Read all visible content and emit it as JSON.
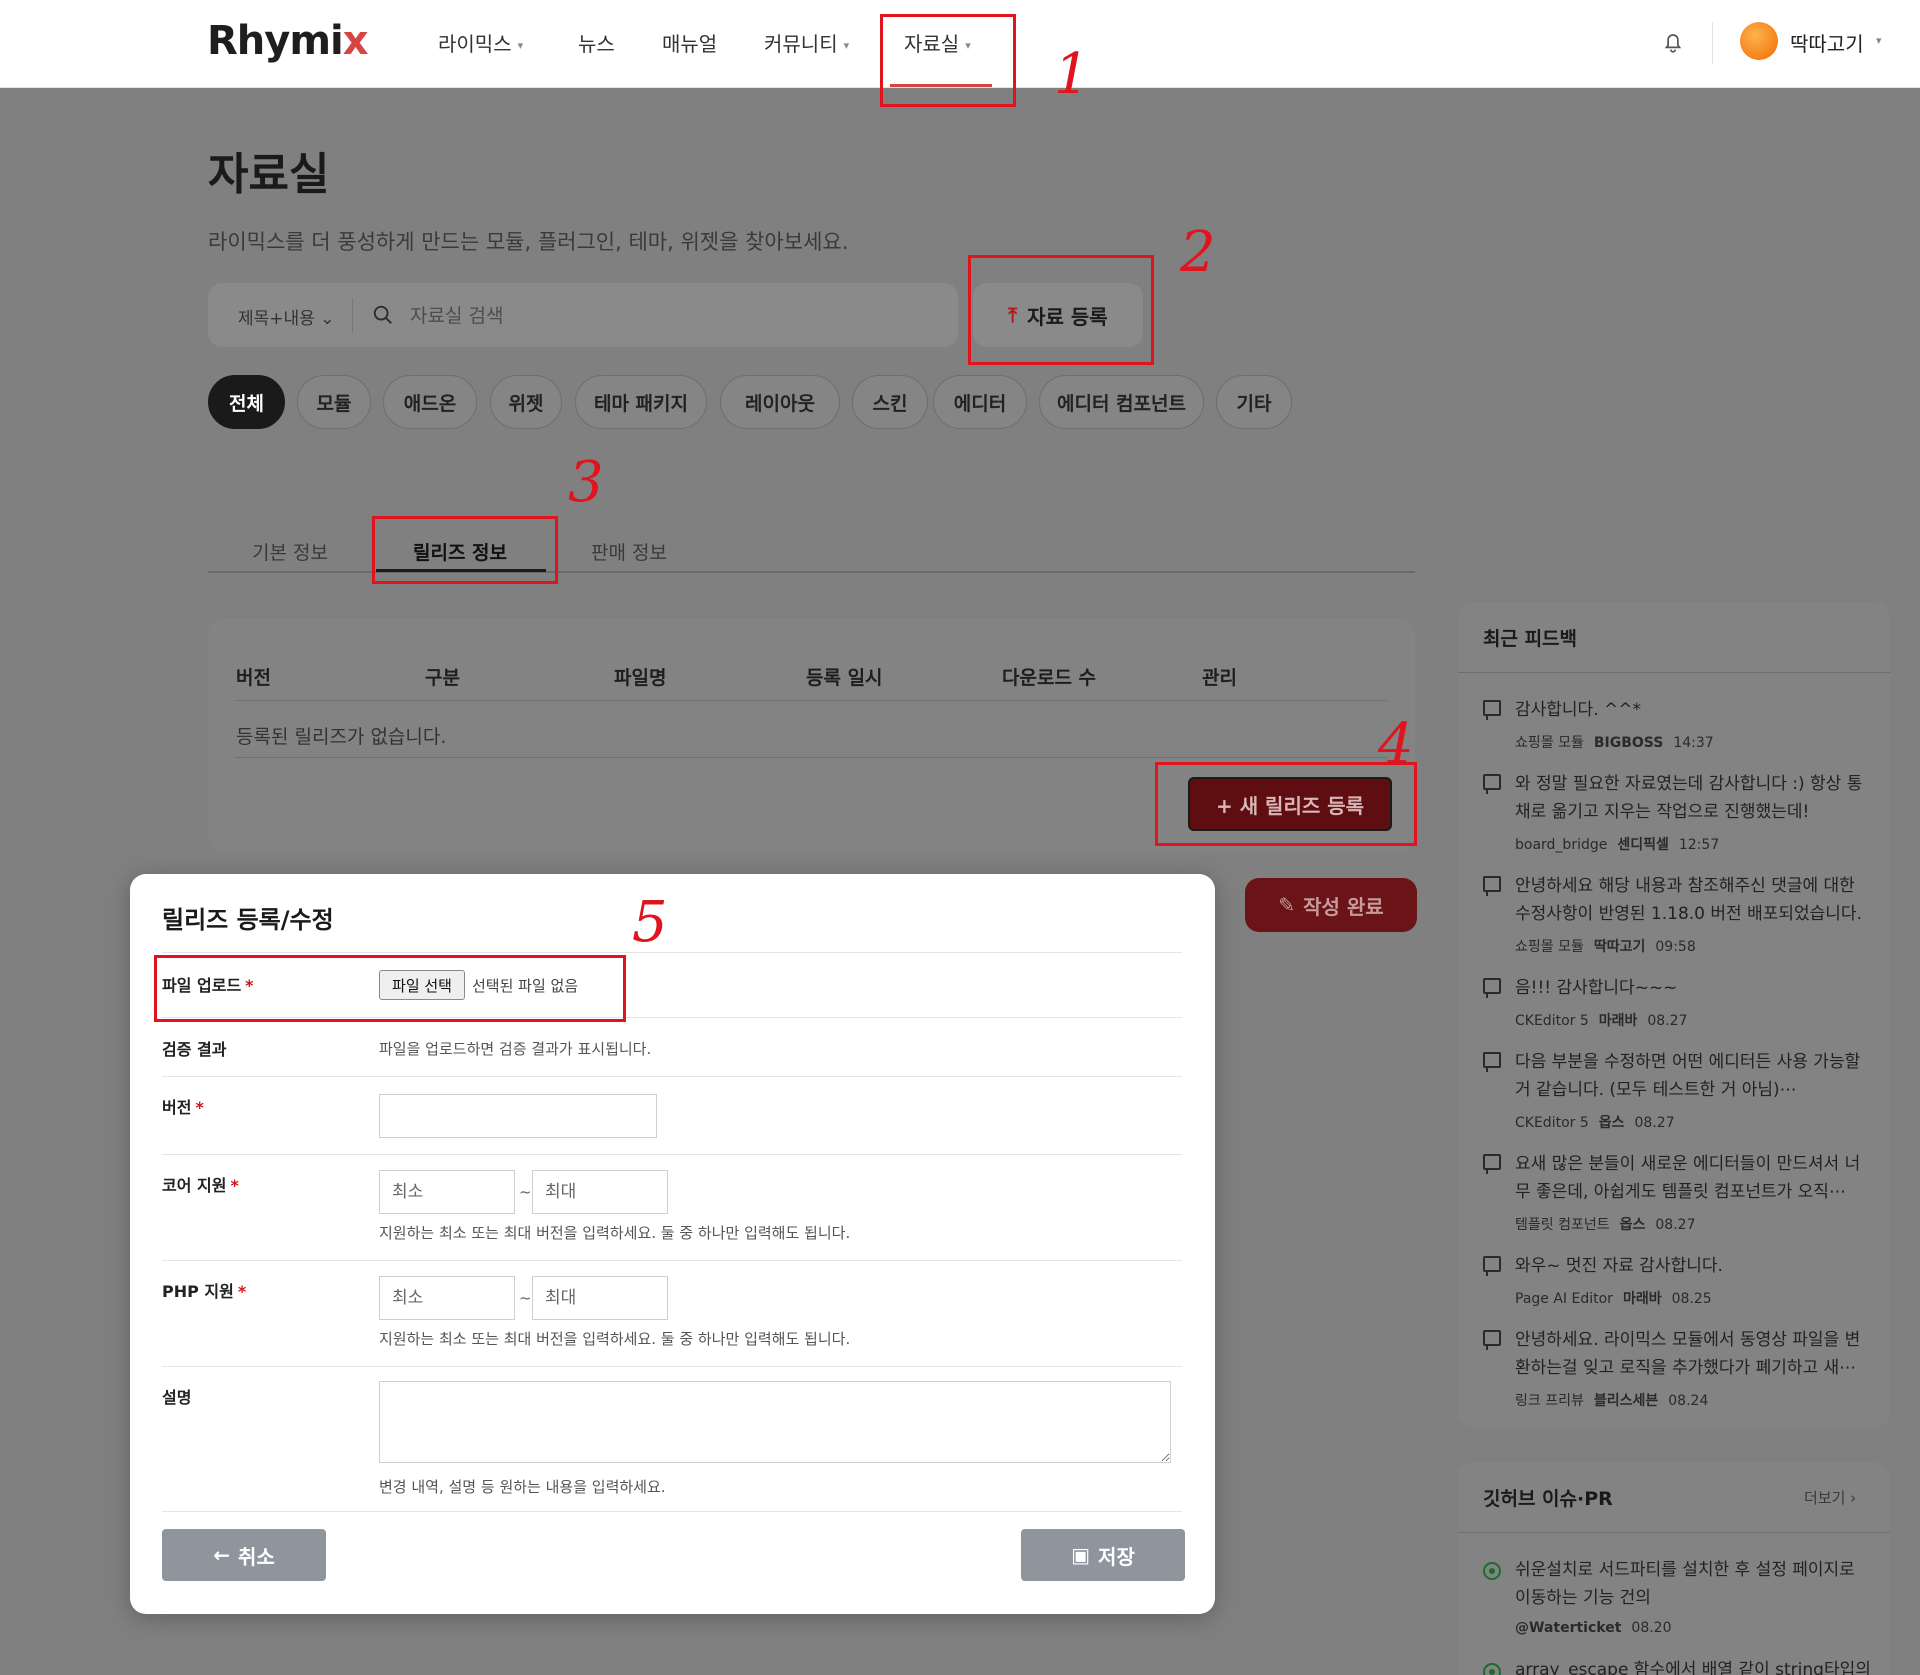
{
  "header": {
    "logo_main": "Rhymi",
    "logo_accent": "x",
    "nav": [
      {
        "label": "라이믹스",
        "has_caret": true
      },
      {
        "label": "뉴스",
        "has_caret": false
      },
      {
        "label": "매뉴얼",
        "has_caret": false
      },
      {
        "label": "커뮤니티",
        "has_caret": true
      },
      {
        "label": "자료실",
        "has_caret": true
      }
    ],
    "caret": "▾",
    "active_nav": "자료실",
    "username": "딱따고기"
  },
  "annotations": {
    "n1": "1",
    "n2": "2",
    "n3": "3",
    "n4": "4",
    "n5": "5"
  },
  "page": {
    "title": "자료실",
    "subtitle": "라이믹스를 더 풍성하게 만드는 모듈, 플러그인, 테마, 위젯을 찾아보세요."
  },
  "search": {
    "scope": "제목+내용",
    "placeholder": "자료실 검색",
    "upload_label": "자료 등록"
  },
  "categories": [
    "전체",
    "모듈",
    "애드온",
    "위젯",
    "테마 패키지",
    "레이아웃",
    "스킨",
    "에디터",
    "에디터 컴포넌트",
    "기타"
  ],
  "tabs": [
    "기본 정보",
    "릴리즈 정보",
    "판매 정보"
  ],
  "release_table": {
    "headers": [
      "버전",
      "구분",
      "파일명",
      "등록 일시",
      "다운로드 수",
      "관리"
    ],
    "empty_text": "등록된 릴리즈가 없습니다.",
    "new_button": "+ 새 릴리즈 등록"
  },
  "done_button": "작성 완료",
  "modal": {
    "title": "릴리즈 등록/수정",
    "file_label": "파일 업로드",
    "file_button": "파일 선택",
    "file_none": "선택된 파일 없음",
    "verify_label": "검증 결과",
    "verify_text": "파일을 업로드하면 검증 결과가 표시됩니다.",
    "version_label": "버전",
    "core_label": "코어 지원",
    "php_label": "PHP 지원",
    "min_placeholder": "최소",
    "max_placeholder": "최대",
    "range_help": "지원하는 최소 또는 최대 버전을 입력하세요. 둘 중 하나만 입력해도 됩니다.",
    "desc_label": "설명",
    "desc_help": "변경 내역, 설명 등 원하는 내용을 입력하세요.",
    "required_mark": "*",
    "cancel_button": "취소",
    "save_button": "저장"
  },
  "feedback": {
    "title": "최근 피드백",
    "items": [
      {
        "text": "감사합니다. ^^*",
        "board": "쇼핑몰 모듈",
        "author": "BIGBOSS",
        "time": "14:37"
      },
      {
        "text": "와 정말 필요한 자료였는데 감사합니다 :) 항상 통채로 옮기고 지우는 작업으로 진행했는데!",
        "board": "board_bridge",
        "author": "센디픽셀",
        "time": "12:57"
      },
      {
        "text": "안녕하세요 해당 내용과 참조해주신 댓글에 대한 수정사항이 반영된 1.18.0 버전 배포되었습니다.",
        "board": "쇼핑몰 모듈",
        "author": "딱따고기",
        "time": "09:58"
      },
      {
        "text": "음!!! 감사합니다~~~",
        "board": "CKEditor 5",
        "author": "마래바",
        "time": "08.27"
      },
      {
        "text": "다음 부분을 수정하면 어떤 에디터든 사용 가능할 거 같습니다. (모두 테스트한 거 아님)⋯",
        "board": "CKEditor 5",
        "author": "옵스",
        "time": "08.27"
      },
      {
        "text": "요새 많은 분들이 새로운 에디터들이 만드셔서 너무 좋은데, 아쉽게도 템플릿 컴포넌트가 오직⋯",
        "board": "템플릿 컴포넌트",
        "author": "옵스",
        "time": "08.27"
      },
      {
        "text": "와우~ 멋진 자료 감사합니다.",
        "board": "Page AI Editor",
        "author": "마래바",
        "time": "08.25"
      },
      {
        "text": "안녕하세요. 라이믹스 모듈에서 동영상 파일을 변환하는걸 잊고 로직을 추가했다가 폐기하고 새⋯",
        "board": "링크 프리뷰",
        "author": "블리스세븐",
        "time": "08.24"
      }
    ]
  },
  "github": {
    "title": "깃허브 이슈·PR",
    "more": "더보기 ›",
    "items": [
      {
        "text": "쉬운설치로 서드파티를 설치한 후 설정 페이지로 이동하는 기능 건의",
        "author": "@Waterticket",
        "time": "08.20"
      },
      {
        "text": "array_escape 함수에서 배열 같이 string타입의",
        "author": "",
        "time": ""
      }
    ]
  }
}
